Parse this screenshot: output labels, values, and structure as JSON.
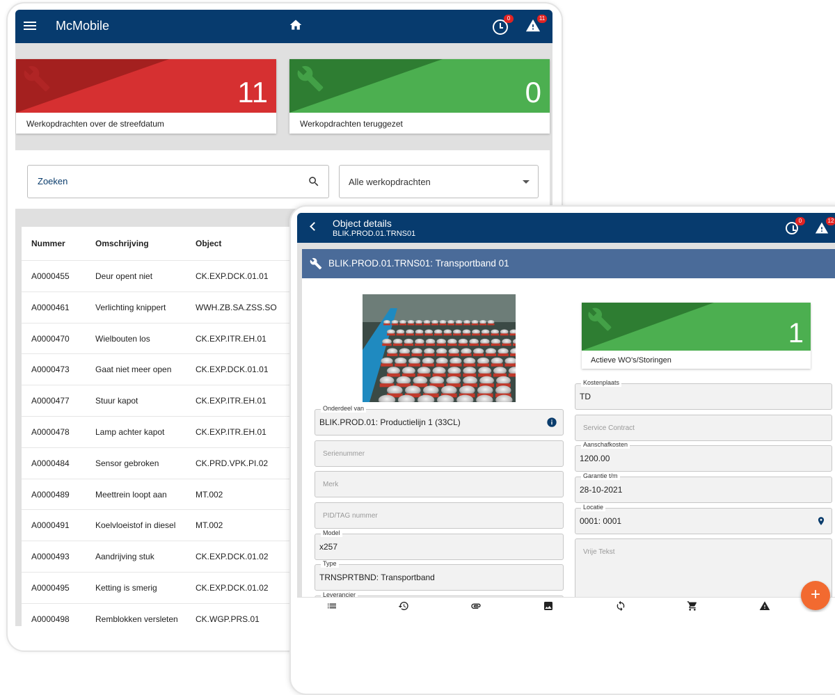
{
  "app": {
    "title": "McMobile",
    "clock_badge": "0",
    "alert_badge": "11"
  },
  "dashboard": {
    "tiles": [
      {
        "label": "Werkopdrachten over de streefdatum",
        "count": "11",
        "color": "#d63031"
      },
      {
        "label": "Werkopdrachten teruggezet",
        "count": "0",
        "color": "#4caf50"
      }
    ]
  },
  "search": {
    "placeholder": "Zoeken",
    "filter_value": "Alle werkopdrachten"
  },
  "table": {
    "headers": [
      "Nummer",
      "Omschrijving",
      "Object"
    ],
    "rows": [
      [
        "A0000455",
        "Deur opent niet",
        "CK.EXP.DCK.01.01"
      ],
      [
        "A0000461",
        "Verlichting knippert",
        "WWH.ZB.SA.ZSS.SO"
      ],
      [
        "A0000470",
        "Wielbouten los",
        "CK.EXP.ITR.EH.01"
      ],
      [
        "A0000473",
        "Gaat niet meer open",
        "CK.EXP.DCK.01.01"
      ],
      [
        "A0000477",
        "Stuur kapot",
        "CK.EXP.ITR.EH.01"
      ],
      [
        "A0000478",
        "Lamp achter kapot",
        "CK.EXP.ITR.EH.01"
      ],
      [
        "A0000484",
        "Sensor gebroken",
        "CK.PRD.VPK.PI.02"
      ],
      [
        "A0000489",
        "Meettrein loopt aan",
        "MT.002"
      ],
      [
        "A0000491",
        "Koelvloeistof in diesel",
        "MT.002"
      ],
      [
        "A0000493",
        "Aandrijving stuk",
        "CK.EXP.DCK.01.02"
      ],
      [
        "A0000495",
        "Ketting is smerig",
        "CK.EXP.DCK.01.02"
      ],
      [
        "A0000498",
        "Remblokken versleten",
        "CK.WGP.PRS.01"
      ]
    ]
  },
  "object_details": {
    "title": "Object details",
    "subtitle": "BLIK.PROD.01.TRNS01",
    "clock_badge": "0",
    "alert_badge": "12",
    "header": "BLIK.PROD.01.TRNS01: Transportband 01",
    "tile": {
      "label": "Actieve WO's/Storingen",
      "count": "1",
      "color": "#4caf50"
    },
    "left_fields": [
      {
        "label": "Onderdeel van",
        "value": "BLIK.PROD.01: Productielijn 1 (33CL)",
        "placeholder": ""
      },
      {
        "label": "",
        "value": "",
        "placeholder": "Serienummer"
      },
      {
        "label": "",
        "value": "",
        "placeholder": "Merk"
      },
      {
        "label": "",
        "value": "",
        "placeholder": "PID/TAG nummer"
      },
      {
        "label": "Model",
        "value": "x257",
        "placeholder": ""
      },
      {
        "label": "Type",
        "value": "TRNSPRTBND: Transportband",
        "placeholder": ""
      },
      {
        "label": "Leverancier",
        "value": "",
        "placeholder": ""
      }
    ],
    "right_fields": [
      {
        "label": "Kostenplaats",
        "value": "TD",
        "placeholder": ""
      },
      {
        "label": "",
        "value": "",
        "placeholder": "Service Contract"
      },
      {
        "label": "Aanschafkosten",
        "value": "1200.00",
        "placeholder": ""
      },
      {
        "label": "Garantie t/m",
        "value": "28-10-2021",
        "placeholder": ""
      },
      {
        "label": "Locatie",
        "value": "0001: 0001",
        "placeholder": ""
      },
      {
        "label": "",
        "value": "",
        "placeholder": "Vrije Tekst"
      }
    ],
    "fab_label": "+"
  }
}
